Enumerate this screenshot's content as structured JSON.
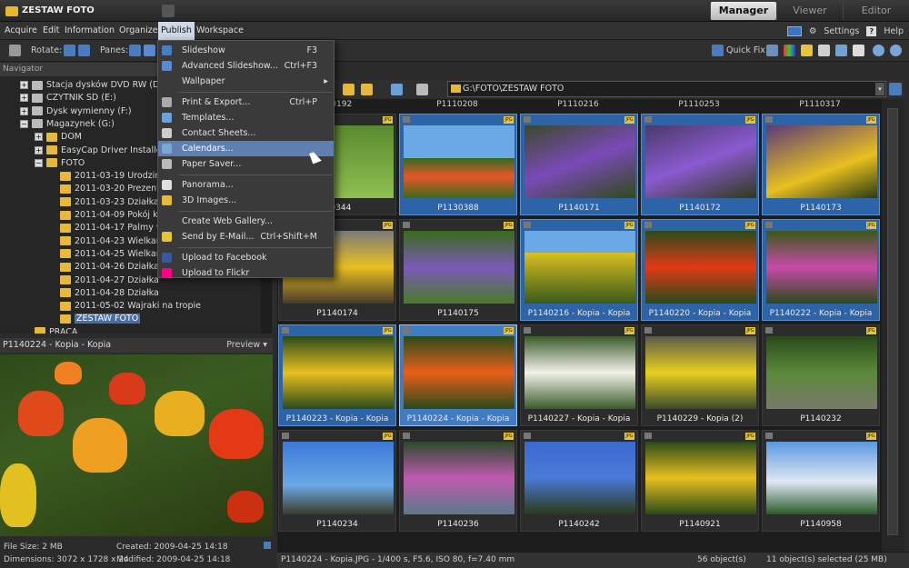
{
  "app": {
    "title": "ZESTAW FOTO"
  },
  "modes": [
    "Manager",
    "Viewer",
    "Editor"
  ],
  "menubar": {
    "items": [
      "Acquire",
      "Edit",
      "Information",
      "Organize",
      "Publish",
      "Workspace"
    ],
    "settings": "Settings",
    "help": "Help"
  },
  "toolbar": {
    "rotate": "Rotate:",
    "panes": "Panes:",
    "quick_fix": "Quick Fix"
  },
  "navigator": {
    "title": "Navigator"
  },
  "tree": [
    {
      "label": "Stacja dysków DVD RW (D:)",
      "type": "drive",
      "exp": "+"
    },
    {
      "label": "CZYTNIK SD (E:)",
      "type": "drive",
      "exp": "+"
    },
    {
      "label": "Dysk wymienny (F:)",
      "type": "drive",
      "exp": "+"
    },
    {
      "label": "Magazynek (G:)",
      "type": "drive",
      "exp": "-"
    },
    {
      "label": "DOM",
      "type": "folder",
      "exp": "+"
    },
    {
      "label": "EasyCap Driver Installer",
      "type": "folder",
      "exp": "+"
    },
    {
      "label": "FOTO",
      "type": "folder",
      "exp": "-"
    },
    {
      "label": "2011-03-19 Urodziny P",
      "type": "folder"
    },
    {
      "label": "2011-03-20 Prezent",
      "type": "folder"
    },
    {
      "label": "2011-03-23 Działka",
      "type": "folder"
    },
    {
      "label": "2011-04-09 Pokój kana",
      "type": "folder"
    },
    {
      "label": "2011-04-17 Palmy w ł",
      "type": "folder"
    },
    {
      "label": "2011-04-23 Wielkanoc",
      "type": "folder"
    },
    {
      "label": "2011-04-25 Wielkanoc",
      "type": "folder"
    },
    {
      "label": "2011-04-26 Działka",
      "type": "folder"
    },
    {
      "label": "2011-04-27 Działka",
      "type": "folder"
    },
    {
      "label": "2011-04-28 Działka",
      "type": "folder"
    },
    {
      "label": "2011-05-02 Wajraki na tropie",
      "type": "folder"
    },
    {
      "label": "ZESTAW FOTO",
      "type": "folder",
      "selected": true
    },
    {
      "label": "PRACA",
      "type": "folder"
    }
  ],
  "preview": {
    "title": "P1140224 - Kopia - Kopia",
    "mode": "Preview"
  },
  "info": {
    "file_size": "File Size: 2 MB",
    "dimensions": "Dimensions: 3072 x 1728 x 24",
    "created": "Created: 2009-04-25 14:18",
    "modified": "Modified: 2009-04-25 14:18"
  },
  "address": {
    "path": "G:\\FOTO\\ZESTAW FOTO"
  },
  "top_captions": [
    "110192",
    "P1110208",
    "P1110216",
    "P1110253",
    "P1110317"
  ],
  "grid": [
    {
      "name": "P1130344",
      "display": "30344"
    },
    {
      "name": "P1130388",
      "display": "P1130388"
    },
    {
      "name": "P1140171",
      "display": "P1140171"
    },
    {
      "name": "P1140172",
      "display": "P1140172"
    },
    {
      "name": "P1140173",
      "display": "P1140173"
    },
    {
      "name": "P1140174",
      "display": "P1140174"
    },
    {
      "name": "P1140175",
      "display": "P1140175"
    },
    {
      "name": "P1140216 - Kopia - Kopia",
      "display": "P1140216 - Kopia - Kopia"
    },
    {
      "name": "P1140220 - Kopia - Kopia",
      "display": "P1140220 - Kopia - Kopia"
    },
    {
      "name": "P1140222 - Kopia - Kopia",
      "display": "P1140222 - Kopia - Kopia"
    },
    {
      "name": "P1140223 - Kopia - Kopia",
      "display": "P1140223 - Kopia - Kopia"
    },
    {
      "name": "P1140224 - Kopia - Kopia",
      "display": "P1140224 - Kopia - Kopia"
    },
    {
      "name": "P1140227 - Kopia - Kopia",
      "display": "P1140227 - Kopia - Kopia"
    },
    {
      "name": "P1140229 - Kopia (2)",
      "display": "P1140229 - Kopia (2)"
    },
    {
      "name": "P1140232",
      "display": "P1140232"
    },
    {
      "name": "P1140234",
      "display": "P1140234"
    },
    {
      "name": "P1140236",
      "display": "P1140236"
    },
    {
      "name": "P1140242",
      "display": "P1140242"
    },
    {
      "name": "P1140921",
      "display": "P1140921"
    },
    {
      "name": "P1140958",
      "display": "P1140958"
    }
  ],
  "publish_menu": [
    {
      "label": "Slideshow",
      "shortcut": "F3",
      "icon": "slideshow-icon"
    },
    {
      "label": "Advanced Slideshow...",
      "shortcut": "Ctrl+F3",
      "icon": "advanced-slideshow-icon"
    },
    {
      "label": "Wallpaper",
      "shortcut": "",
      "submenu": true,
      "icon": ""
    },
    {
      "sep": true
    },
    {
      "label": "Print & Export...",
      "shortcut": "Ctrl+P",
      "icon": "printer-icon"
    },
    {
      "label": "Templates...",
      "shortcut": "",
      "icon": "template-icon"
    },
    {
      "label": "Contact Sheets...",
      "shortcut": "",
      "icon": "contact-sheet-icon"
    },
    {
      "label": "Calendars...",
      "shortcut": "",
      "icon": "calendar-icon",
      "highlight": true
    },
    {
      "label": "Paper Saver...",
      "shortcut": "",
      "icon": "paper-saver-icon"
    },
    {
      "sep": true
    },
    {
      "label": "Panorama...",
      "shortcut": "",
      "icon": "panorama-icon"
    },
    {
      "label": "3D Images...",
      "shortcut": "",
      "icon": "3d-images-icon"
    },
    {
      "sep": true
    },
    {
      "label": "Create Web Gallery...",
      "shortcut": "",
      "icon": ""
    },
    {
      "label": "Send by E-Mail...",
      "shortcut": "Ctrl+Shift+M",
      "icon": "email-icon"
    },
    {
      "sep": true
    },
    {
      "label": "Upload to Facebook",
      "shortcut": "",
      "icon": "facebook-icon"
    },
    {
      "label": "Upload to Flickr",
      "shortcut": "",
      "icon": "flickr-icon"
    }
  ],
  "status": {
    "file": "P1140224 - Kopia.JPG - 1/400 s, F5.6, ISO 80, f=7.40 mm",
    "count": "56 object(s)",
    "selected": "11 object(s) selected (25 MB)"
  },
  "colors": {
    "accent": "#2d64a8",
    "highlight": "#5f7fb0"
  }
}
